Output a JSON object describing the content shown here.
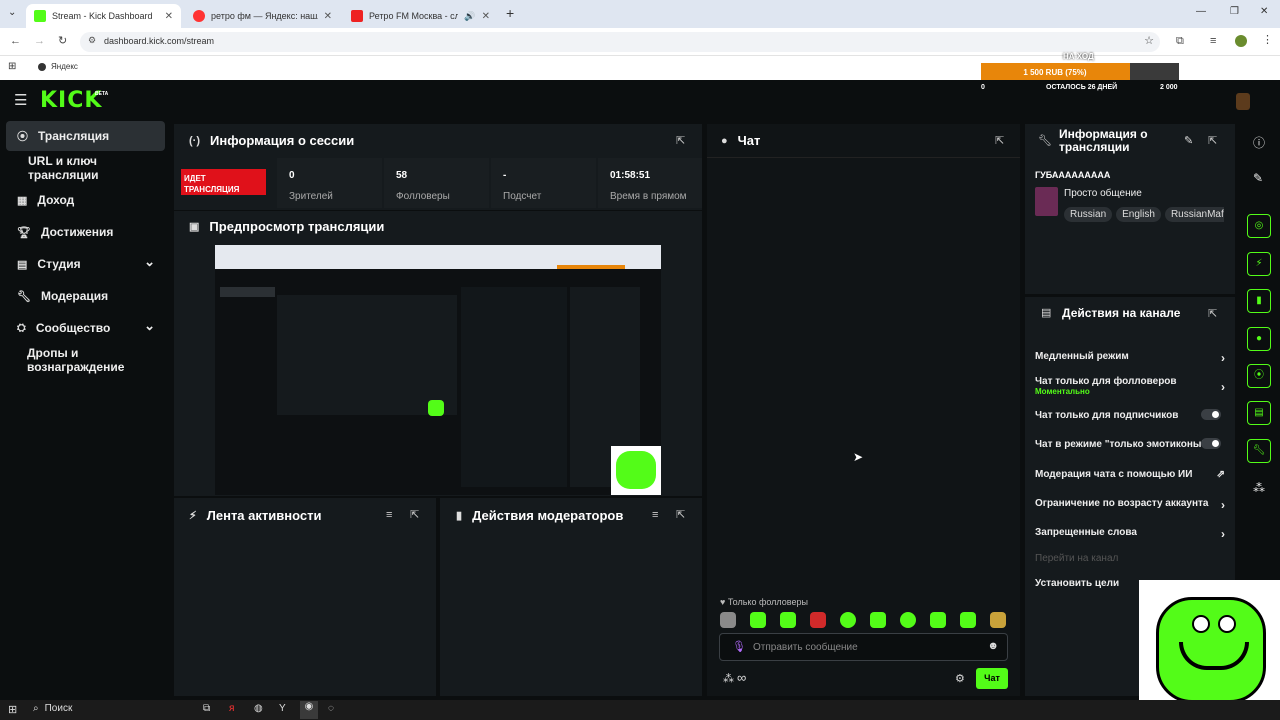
{
  "browser": {
    "tabs": [
      {
        "title": "Stream - Kick Dashboard",
        "close": "✕"
      },
      {
        "title": "ретро фм — Яндекс: нашлось",
        "close": "✕"
      },
      {
        "title": "Ретро FM Москва - слуша",
        "close": "✕"
      }
    ],
    "new_tab": "+",
    "url": "dashboard.kick.com/stream",
    "bookmark": "Яндекс"
  },
  "goal_overlay": {
    "header": "НА ХОД",
    "amount": "1 500 RUB (75%)",
    "progress_fraction": 0.75,
    "left_value": "0",
    "remaining": "ОСТАЛОСЬ 26 ДНЕЙ",
    "right_value": "2 000"
  },
  "kick": {
    "logo": "KICK",
    "beta": "BETA"
  },
  "sidebar": {
    "items": [
      {
        "label": "Трансляция",
        "icon": "broadcast-icon"
      },
      {
        "label": "URL и ключ трансляции",
        "icon": ""
      },
      {
        "label": "Доход",
        "icon": "chart-icon"
      },
      {
        "label": "Достижения",
        "icon": "trophy-icon"
      },
      {
        "label": "Студия",
        "icon": "studio-icon",
        "chevron": "⌄"
      },
      {
        "label": "Модерация",
        "icon": "wrench-icon"
      },
      {
        "label": "Сообщество",
        "icon": "community-icon",
        "chevron": "⌄"
      },
      {
        "label": "Дропы и вознаграждение",
        "icon": ""
      }
    ]
  },
  "session": {
    "title": "Информация о сессии",
    "live_badge": "ИДЕТ ТРАНСЛЯЦИЯ",
    "stats": [
      {
        "value": "0",
        "label": "Зрителей"
      },
      {
        "value": "58",
        "label": "Фолловеры"
      },
      {
        "value": "-",
        "label": "Подсчет"
      },
      {
        "value": "01:58:51",
        "label": "Время в прямом"
      }
    ]
  },
  "preview": {
    "title": "Предпросмотр трансляции"
  },
  "activity": {
    "title": "Лента активности"
  },
  "mod_actions": {
    "title": "Действия модераторов"
  },
  "chat": {
    "title": "Чат",
    "followers_only": "Только фолловеры",
    "placeholder": "Отправить сообщение",
    "send": "Чат",
    "infinity": "∞"
  },
  "stream_info": {
    "title": "Информация о трансляции",
    "channel": "ГУБААААААААА",
    "stream_title": "Просто общение",
    "tags": [
      "Russian",
      "English",
      "RussianMafia"
    ]
  },
  "channel_actions": {
    "title": "Действия на канале",
    "items": [
      {
        "label": "Медленный режим",
        "control": "chevron"
      },
      {
        "label": "Чат только для фолловеров",
        "sub": "Моментально",
        "control": "chevron"
      },
      {
        "label": "Чат только для подписчиков",
        "control": "toggle"
      },
      {
        "label": "Чат в режиме \"только эмотиконы\"",
        "control": "toggle"
      },
      {
        "label": "Модерация чата с помощью ИИ",
        "control": "external"
      },
      {
        "label": "Ограничение по возрасту аккаунта",
        "control": "chevron"
      },
      {
        "label": "Запрещенные слова",
        "control": "chevron"
      },
      {
        "label": "Перейти на канал",
        "control": "none"
      },
      {
        "label": "Установить цели",
        "control": "none"
      }
    ]
  },
  "taskbar": {
    "search": "Поиск"
  },
  "colors": {
    "accent": "#53fc18",
    "live": "#e0111a",
    "panel": "#151a1d",
    "bg": "#0b0e0f",
    "goal": "#e8860a"
  }
}
